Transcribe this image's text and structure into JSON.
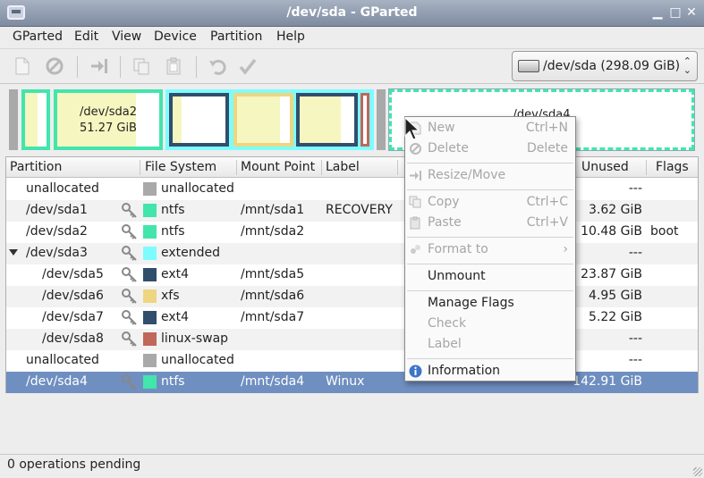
{
  "window": {
    "title": "/dev/sda - GParted"
  },
  "menubar": [
    "GParted",
    "Edit",
    "View",
    "Device",
    "Partition",
    "Help"
  ],
  "device_selector": {
    "label": "/dev/sda  (298.09 GiB)"
  },
  "diskmap": {
    "sda2": {
      "name": "/dev/sda2",
      "size": "51.27 GiB"
    },
    "sda4": {
      "name": "/dev/sda4"
    }
  },
  "table": {
    "columns": [
      "Partition",
      "File System",
      "Mount Point",
      "Label",
      "Unused",
      "Flags"
    ],
    "rows": [
      {
        "partition": "unallocated",
        "fs": "unallocated",
        "fs_color": "#a9a9a9",
        "mount": "",
        "label": "",
        "unused": "---",
        "flags": "",
        "key": false,
        "indent": 0,
        "expander": false
      },
      {
        "partition": "/dev/sda1",
        "fs": "ntfs",
        "fs_color": "#42e5ac",
        "mount": "/mnt/sda1",
        "label": "RECOVERY",
        "unused": "3.62 GiB",
        "flags": "",
        "key": true,
        "indent": 0,
        "expander": false
      },
      {
        "partition": "/dev/sda2",
        "fs": "ntfs",
        "fs_color": "#42e5ac",
        "mount": "/mnt/sda2",
        "label": "",
        "unused": "10.48 GiB",
        "flags": "boot",
        "key": true,
        "indent": 0,
        "expander": false
      },
      {
        "partition": "/dev/sda3",
        "fs": "extended",
        "fs_color": "#7dfcfe",
        "mount": "",
        "label": "",
        "unused": "---",
        "flags": "",
        "key": true,
        "indent": 0,
        "expander": true
      },
      {
        "partition": "/dev/sda5",
        "fs": "ext4",
        "fs_color": "#314e6c",
        "mount": "/mnt/sda5",
        "label": "",
        "unused": "23.87 GiB",
        "flags": "",
        "key": true,
        "indent": 1,
        "expander": false
      },
      {
        "partition": "/dev/sda6",
        "fs": "xfs",
        "fs_color": "#eed680",
        "mount": "/mnt/sda6",
        "label": "",
        "unused": "4.95 GiB",
        "flags": "",
        "key": true,
        "indent": 1,
        "expander": false
      },
      {
        "partition": "/dev/sda7",
        "fs": "ext4",
        "fs_color": "#314e6c",
        "mount": "/mnt/sda7",
        "label": "",
        "unused": "5.22 GiB",
        "flags": "",
        "key": true,
        "indent": 1,
        "expander": false
      },
      {
        "partition": "/dev/sda8",
        "fs": "linux-swap",
        "fs_color": "#c1665a",
        "mount": "",
        "label": "",
        "unused": "---",
        "flags": "",
        "key": true,
        "indent": 1,
        "expander": false
      },
      {
        "partition": "unallocated",
        "fs": "unallocated",
        "fs_color": "#a9a9a9",
        "mount": "",
        "label": "",
        "unused": "---",
        "flags": "",
        "key": false,
        "indent": 0,
        "expander": false
      },
      {
        "partition": "/dev/sda4",
        "fs": "ntfs",
        "fs_color": "#42e5ac",
        "mount": "/mnt/sda4",
        "label": "Winux",
        "unused": "142.91 GiB",
        "flags": "",
        "key": true,
        "indent": 0,
        "expander": false,
        "selected": true
      }
    ]
  },
  "context_menu": [
    {
      "label": "New",
      "accel": "Ctrl+N",
      "disabled": true,
      "icon": "new-icon"
    },
    {
      "label": "Delete",
      "accel": "Delete",
      "disabled": true,
      "icon": "delete-icon"
    },
    {
      "sep": true
    },
    {
      "label": "Resize/Move",
      "accel": "",
      "disabled": true,
      "icon": "resize-icon"
    },
    {
      "sep": true
    },
    {
      "label": "Copy",
      "accel": "Ctrl+C",
      "disabled": true,
      "icon": "copy-icon"
    },
    {
      "label": "Paste",
      "accel": "Ctrl+V",
      "disabled": true,
      "icon": "paste-icon"
    },
    {
      "sep": true
    },
    {
      "label": "Format to",
      "accel": "",
      "disabled": true,
      "icon": "format-icon",
      "submenu": true
    },
    {
      "sep": true
    },
    {
      "label": "Unmount",
      "accel": "",
      "disabled": false,
      "icon": ""
    },
    {
      "sep": true
    },
    {
      "label": "Manage Flags",
      "accel": "",
      "disabled": false,
      "icon": ""
    },
    {
      "label": "Check",
      "accel": "",
      "disabled": true,
      "icon": ""
    },
    {
      "label": "Label",
      "accel": "",
      "disabled": true,
      "icon": ""
    },
    {
      "sep": true
    },
    {
      "label": "Information",
      "accel": "",
      "disabled": false,
      "icon": "info-icon"
    }
  ],
  "status": {
    "text": "0 operations pending"
  }
}
